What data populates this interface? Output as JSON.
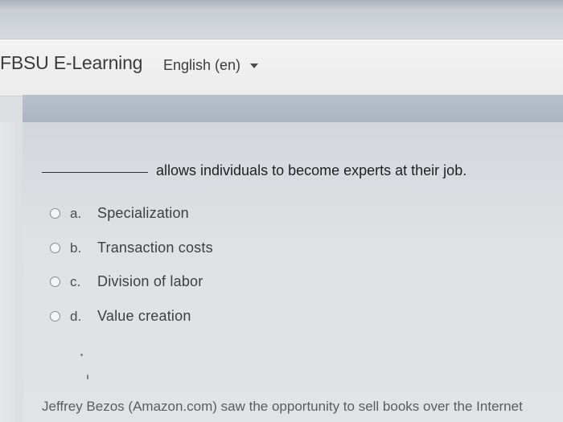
{
  "header": {
    "brand": "FBSU E-Learning",
    "language": "English (en)"
  },
  "question": {
    "stem": "allows individuals to become experts at their job.",
    "options": [
      {
        "letter": "a.",
        "text": "Specialization"
      },
      {
        "letter": "b.",
        "text": "Transaction costs"
      },
      {
        "letter": "c.",
        "text": "Division of labor"
      },
      {
        "letter": "d.",
        "text": "Value creation"
      }
    ]
  },
  "next_question": {
    "text": "Jeffrey Bezos (Amazon.com) saw the opportunity to sell books over the Internet"
  },
  "icons": {
    "language_caret": "caret-down-icon",
    "radio": "radio-unchecked-icon"
  }
}
